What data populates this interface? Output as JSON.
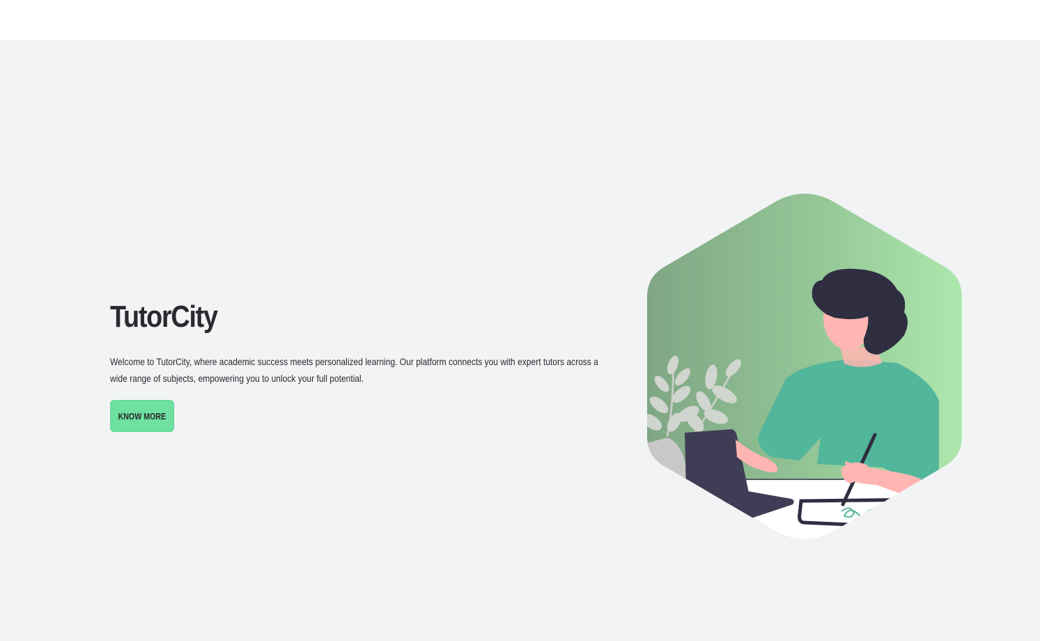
{
  "hero": {
    "title": "TutorCity",
    "description": "Welcome to TutorCity, where academic success meets personalized learning. Our platform connects you with expert tutors across a wide range of subjects, empowering you to unlock your full potential.",
    "cta_label": "KNOW MORE"
  },
  "colors": {
    "page_background": "#f2f3f5",
    "header_background": "#ffffff",
    "button_background": "#6ee0a0",
    "text": "#2a2a2e",
    "illustration_green_dark": "#7fa684",
    "illustration_green_light": "#aee8ad",
    "shirt": "#52b69a",
    "hair": "#2f2e41",
    "skin": "#ffb6b3",
    "laptop": "#3f3d56"
  },
  "icons": {
    "illustration": "person-writing-on-tablet-illustration"
  }
}
